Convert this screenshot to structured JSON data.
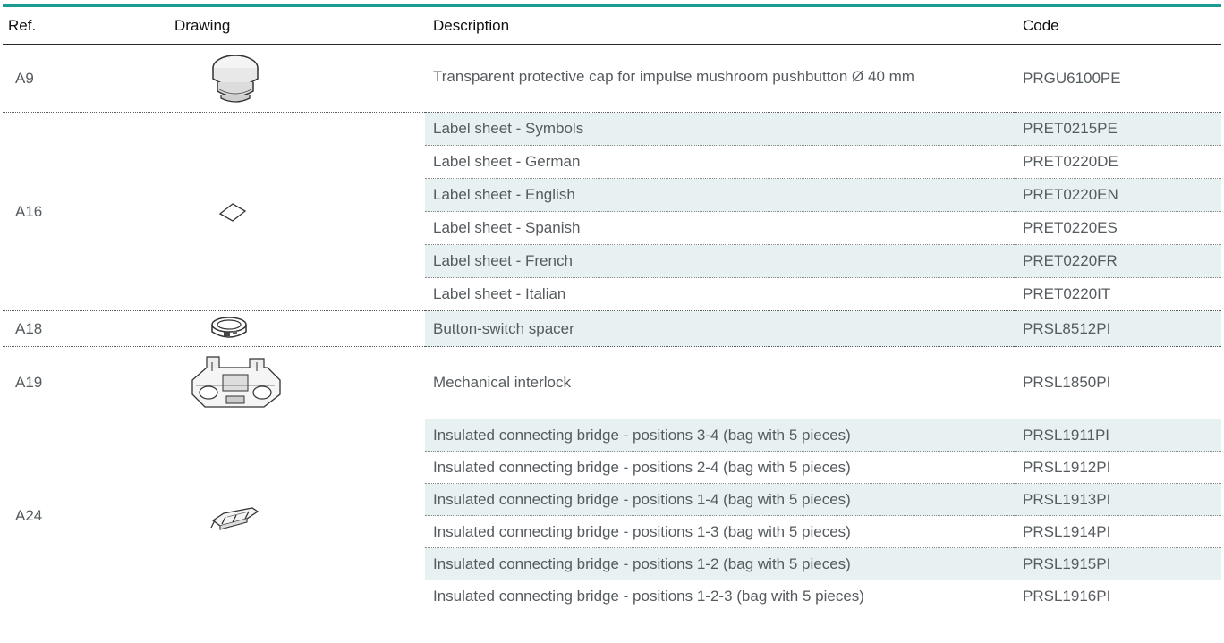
{
  "headers": {
    "ref": "Ref.",
    "drawing": "Drawing",
    "description": "Description",
    "code": "Code"
  },
  "groups": [
    {
      "ref": "A9",
      "icon": "mushroom-cap-icon",
      "items": [
        {
          "description": "Transparent protective cap for impulse mushroom pushbutton Ø 40 mm",
          "code": "PRGU6100PE"
        }
      ]
    },
    {
      "ref": "A16",
      "icon": "label-sheet-icon",
      "items": [
        {
          "description": "Label sheet - Symbols",
          "code": "PRET0215PE"
        },
        {
          "description": "Label sheet - German",
          "code": "PRET0220DE"
        },
        {
          "description": "Label sheet - English",
          "code": "PRET0220EN"
        },
        {
          "description": "Label sheet - Spanish",
          "code": "PRET0220ES"
        },
        {
          "description": "Label sheet - French",
          "code": "PRET0220FR"
        },
        {
          "description": "Label sheet - Italian",
          "code": "PRET0220IT"
        }
      ]
    },
    {
      "ref": "A18",
      "icon": "spacer-ring-icon",
      "items": [
        {
          "description": "Button-switch spacer",
          "code": "PRSL8512PI"
        }
      ]
    },
    {
      "ref": "A19",
      "icon": "mechanical-interlock-icon",
      "items": [
        {
          "description": "Mechanical interlock",
          "code": "PRSL1850PI"
        }
      ]
    },
    {
      "ref": "A24",
      "icon": "connecting-bridge-icon",
      "items": [
        {
          "description": "Insulated connecting bridge - positions 3-4 (bag with 5 pieces)",
          "code": "PRSL1911PI"
        },
        {
          "description": "Insulated connecting bridge - positions 2-4 (bag with 5 pieces)",
          "code": "PRSL1912PI"
        },
        {
          "description": "Insulated connecting bridge - positions 1-4 (bag with 5 pieces)",
          "code": "PRSL1913PI"
        },
        {
          "description": "Insulated connecting bridge - positions 1-3 (bag with 5 pieces)",
          "code": "PRSL1914PI"
        },
        {
          "description": "Insulated connecting bridge - positions 1-2 (bag with 5 pieces)",
          "code": "PRSL1915PI"
        },
        {
          "description": "Insulated connecting bridge - positions 1-2-3 (bag with 5 pieces)",
          "code": "PRSL1916PI"
        }
      ]
    }
  ],
  "colors": {
    "accent": "#1a9c95",
    "row_shade": "#e8f1f2",
    "text": "#555b5e"
  }
}
